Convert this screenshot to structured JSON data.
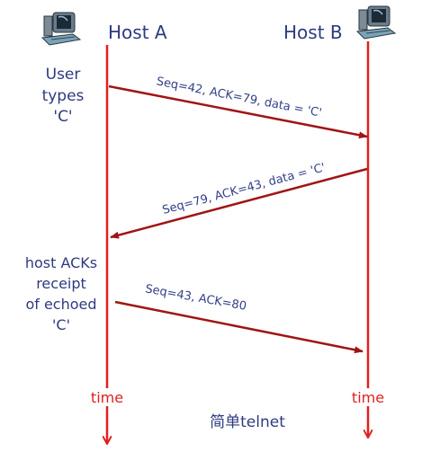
{
  "hosts": {
    "a": "Host A",
    "b": "Host B"
  },
  "notes": {
    "user_types": [
      "User",
      "types",
      "'C'"
    ],
    "host_acks": [
      "host ACKs",
      "receipt",
      "of echoed",
      "'C'"
    ]
  },
  "messages": [
    {
      "label": "Seq=42, ACK=79, data = 'C'",
      "from": "Host A",
      "to": "Host B"
    },
    {
      "label": "Seq=79, ACK=43, data = 'C'",
      "from": "Host B",
      "to": "Host A"
    },
    {
      "label": "Seq=43, ACK=80",
      "from": "Host A",
      "to": "Host B"
    }
  ],
  "time_label": "time",
  "caption": "简单telnet",
  "colors": {
    "timeline": "#e02020",
    "arrow": "#a01515",
    "text": "#2e3a80"
  },
  "icons": [
    "computer-icon",
    "computer-icon"
  ]
}
